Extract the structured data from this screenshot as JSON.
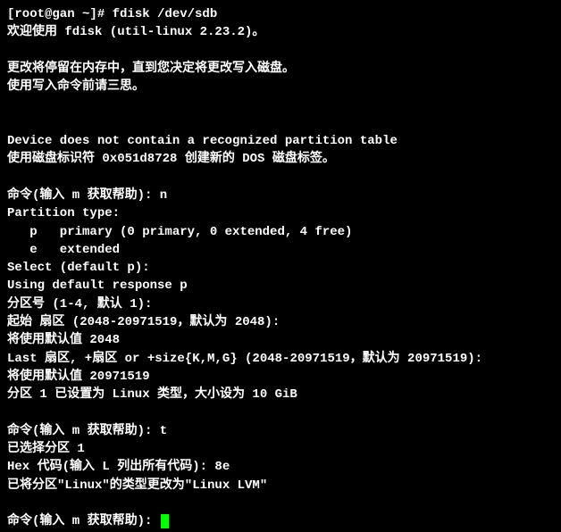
{
  "terminal": {
    "lines": [
      "[root@gan ~]# fdisk /dev/sdb",
      "欢迎使用 fdisk (util-linux 2.23.2)。",
      "",
      "更改将停留在内存中，直到您决定将更改写入磁盘。",
      "使用写入命令前请三思。",
      "",
      "",
      "Device does not contain a recognized partition table",
      "使用磁盘标识符 0x051d8728 创建新的 DOS 磁盘标签。",
      "",
      "命令(输入 m 获取帮助): n",
      "Partition type:",
      "   p   primary (0 primary, 0 extended, 4 free)",
      "   e   extended",
      "Select (default p):",
      "Using default response p",
      "分区号 (1-4, 默认 1):",
      "起始 扇区 (2048-20971519，默认为 2048):",
      "将使用默认值 2048",
      "Last 扇区, +扇区 or +size{K,M,G} (2048-20971519，默认为 20971519):",
      "将使用默认值 20971519",
      "分区 1 已设置为 Linux 类型，大小设为 10 GiB",
      "",
      "命令(输入 m 获取帮助): t",
      "已选择分区 1",
      "Hex 代码(输入 L 列出所有代码): 8e",
      "已将分区\"Linux\"的类型更改为\"Linux LVM\"",
      "",
      "命令(输入 m 获取帮助): "
    ],
    "cursor_visible": true
  }
}
